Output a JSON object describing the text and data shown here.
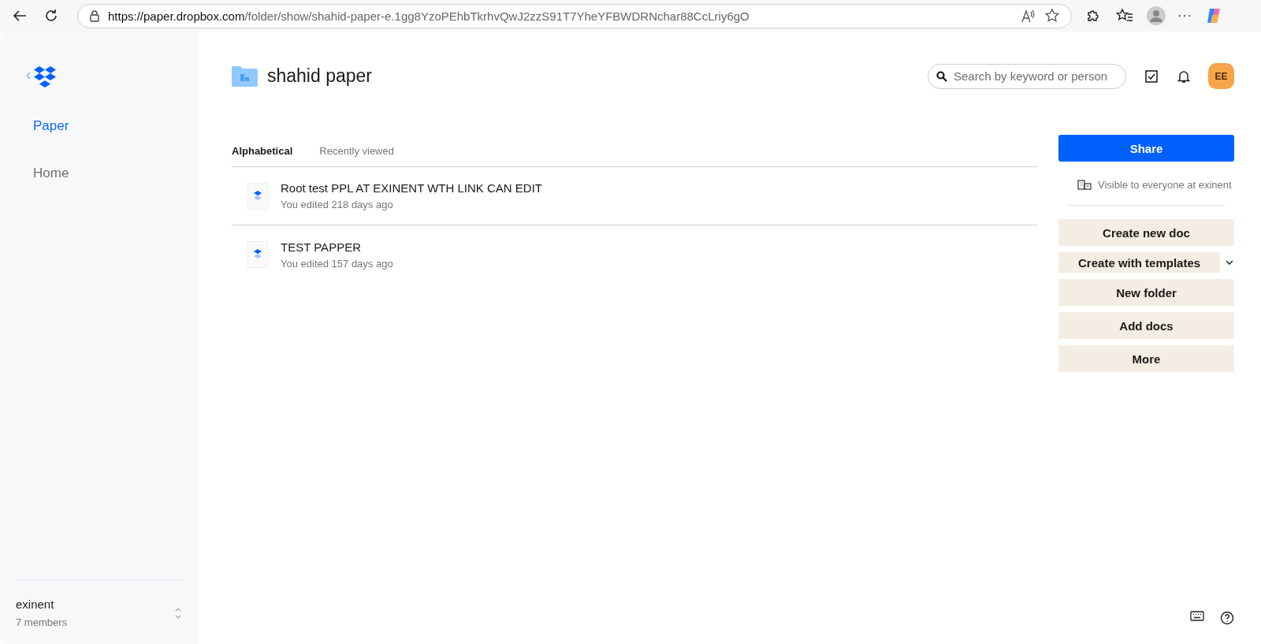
{
  "browser": {
    "url_host": "https://paper.dropbox.com",
    "url_path": "/folder/show/shahid-paper-e.1gg8YzoPEhbTkrhvQwJ2zzS91T7YheYFBWDRNchar88CcLriy6gO",
    "menu_dots": "···"
  },
  "sidebar": {
    "items": [
      {
        "label": "Paper",
        "selected": true
      },
      {
        "label": "Home",
        "selected": false
      }
    ],
    "team": {
      "name": "exinent",
      "members": "7 members"
    }
  },
  "folder": {
    "title": "shahid paper"
  },
  "search": {
    "placeholder": "Search by keyword or person"
  },
  "avatar": {
    "initials": "EE"
  },
  "tabs": [
    {
      "label": "Alphabetical",
      "selected": true
    },
    {
      "label": "Recently viewed",
      "selected": false
    }
  ],
  "docs": [
    {
      "title": "Root test PPL AT EXINENT WTH LINK CAN EDIT",
      "meta": "You edited 218 days ago"
    },
    {
      "title": "TEST PAPPER",
      "meta": "You edited 157 days ago"
    }
  ],
  "panel": {
    "share": "Share",
    "visibility": "Visible to everyone at exinent",
    "actions": [
      {
        "label": "Create new doc",
        "kind": "button"
      },
      {
        "label": "Create with templates",
        "kind": "dropdown"
      },
      {
        "label": "New folder",
        "kind": "button"
      },
      {
        "label": "Add docs",
        "kind": "button"
      },
      {
        "label": "More",
        "kind": "button"
      }
    ]
  }
}
